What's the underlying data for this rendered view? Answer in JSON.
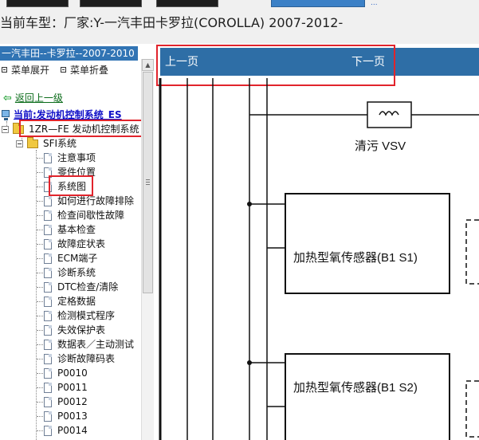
{
  "header": {
    "current_model": "当前车型：厂家:Y-一汽丰田卡罗拉(COROLLA) 2007-2012-",
    "ellipsis_link": "..."
  },
  "sidebar": {
    "model_header": "一汽丰田--卡罗拉--2007-2010",
    "expand_label": "菜单展开",
    "collapse_label": "菜单折叠",
    "back_label": "返回上一级",
    "current_system": "当前:发动机控制系统_ES",
    "engine_node": "1ZR—FE 发动机控制系统",
    "folder_node": "SFI系统",
    "items": [
      "注意事项",
      "零件位置",
      "系统图",
      "如何进行故障排除",
      "检查间歇性故障",
      "基本检查",
      "故障症状表",
      "ECM端子",
      "诊断系统",
      "DTC检查/清除",
      "定格数据",
      "检测模式程序",
      "失效保护表",
      "数据表／主动测试",
      "诊断故障码表",
      "P0010",
      "P0011",
      "P0012",
      "P0013",
      "P0014"
    ],
    "selected_item": "系统图"
  },
  "content": {
    "prev_page": "上一页",
    "next_page": "下一页",
    "diagram": {
      "vsv_label": "清污 VSV",
      "sensor_1_label": "加热型氧传感器(B1 S1)",
      "sensor_2_label": "加热型氧传感器(B1 S2)"
    }
  },
  "colors": {
    "highlight_box": "#e1242c",
    "nav_bar": "#2e6ea6",
    "sidebar_header": "#3174b4"
  }
}
